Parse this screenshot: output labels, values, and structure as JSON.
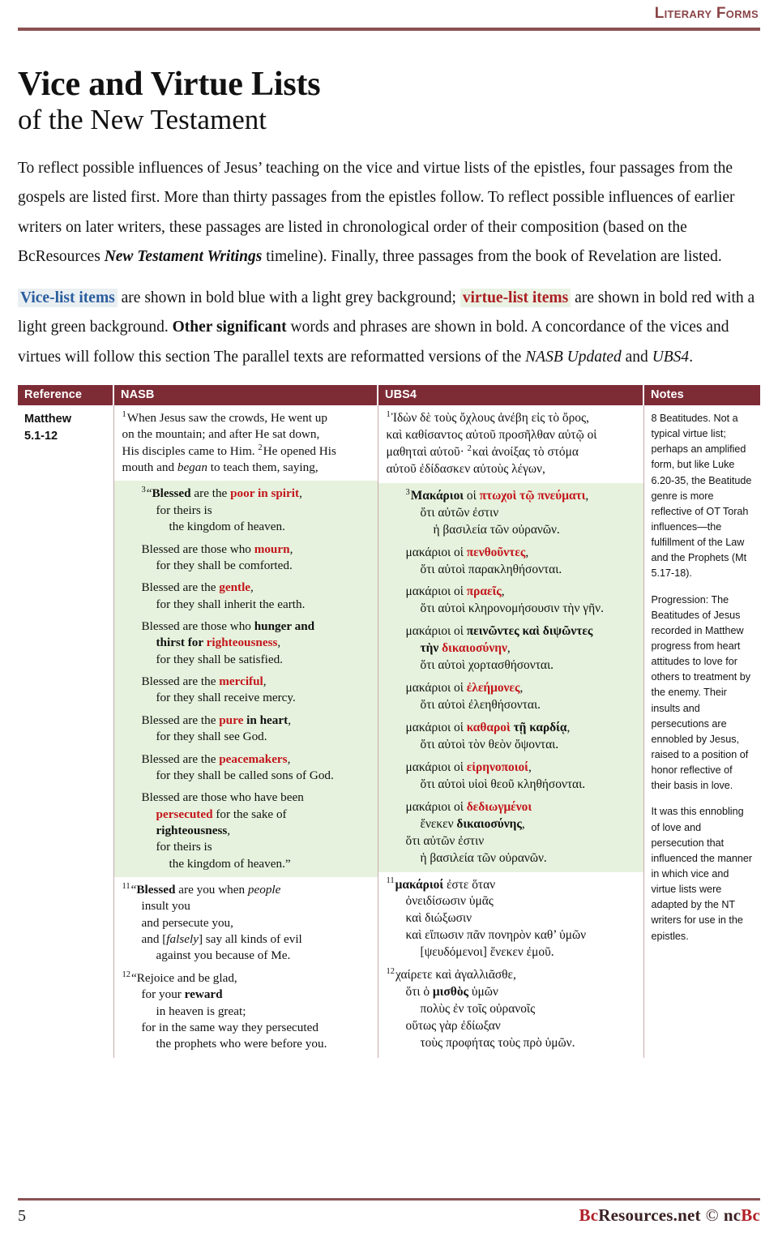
{
  "running_head": "Literary Forms",
  "title": {
    "main": "Vice and Virtue Lists",
    "sub": "of the New Testament"
  },
  "intro": {
    "p1_a": "To reflect possible influences of Jesus’ teaching on the vice and virtue lists of the epistles, four passages from the gospels are listed first. More than thirty passages from the epistles follow. To reflect possible influences of earlier writers on later writers, these passages are listed in chronological order of their composition (based on the BcResources ",
    "p1_italic": "New Testament Writings",
    "p1_b": " timeline). Finally, three passages from the book of Revelation are listed.",
    "p2_vice_kw": "Vice-list items",
    "p2_a": " are shown in bold blue with a light grey background; ",
    "p2_virtue_kw": "virtue-list items",
    "p2_b": " are shown in bold red with a light green background. ",
    "p2_bold": "Other significant",
    "p2_c": " words and phrases are shown in bold. A concordance of the vices and virtues will follow this section The parallel texts are reformatted versions of the ",
    "p2_italic1": "NASB Updated",
    "p2_d": " and ",
    "p2_italic2": "UBS4",
    "p2_e": "."
  },
  "table": {
    "headers": {
      "reference": "Reference",
      "nasb": "NASB",
      "ubs4": "UBS4",
      "notes": "Notes"
    },
    "row": {
      "reference_book": "Matthew",
      "reference_verses": "5.1-12",
      "nasb": {
        "intro": {
          "verse": "1",
          "lines": [
            "When Jesus saw the crowds, He went up",
            "on the mountain; and after He sat down,",
            "His disciples came to Him."
          ],
          "verse2": "2",
          "line2a": "He opened His",
          "line2b_pre": "mouth and ",
          "line2b_italic": "began",
          "line2b_post": " to teach them, saying,"
        },
        "beatitudes_verse": "3",
        "beatitudes": [
          {
            "open": "“",
            "blessed": "Blessed",
            "pre": " are the ",
            "virtue": "poor in spirit",
            "post": ",",
            "reason": [
              "for theirs is",
              "the kingdom of heaven."
            ]
          },
          {
            "pre": "Blessed are those who ",
            "virtue": "mourn",
            "post": ",",
            "reason": [
              "for they shall be comforted."
            ]
          },
          {
            "pre": "Blessed are the ",
            "virtue": "gentle",
            "post": ",",
            "reason": [
              "for they shall inherit the earth."
            ]
          },
          {
            "pre": "Blessed are those who ",
            "bold_a": "hunger and",
            "bold_b": "thirst for ",
            "virtue": "righteousness",
            "post": ",",
            "reason": [
              "for they shall be satisfied."
            ]
          },
          {
            "pre": "Blessed are the ",
            "virtue": "merciful",
            "post": ",",
            "reason": [
              "for they shall receive mercy."
            ]
          },
          {
            "pre": "Blessed are the ",
            "virtue": "pure",
            "bold_tail": " in heart",
            "post": ",",
            "reason": [
              "for they shall see God."
            ]
          },
          {
            "pre": "Blessed are the ",
            "virtue": "peacemakers",
            "post": ",",
            "reason": [
              "for they shall be called sons of God."
            ]
          },
          {
            "pre": "Blessed are those who have been",
            "virtue": "persecuted",
            "mid": " for the sake of",
            "bold_tail": "righteousness",
            "post": ",",
            "reason": [
              "for theirs is",
              "the kingdom of heaven.”"
            ]
          }
        ],
        "v11": {
          "num": "11",
          "open": "“",
          "blessed": "Blessed",
          "l1_post": " are you when ",
          "l1_italic": "people",
          "lines": [
            "insult you",
            "and persecute you,"
          ],
          "l4_pre": "and [",
          "l4_italic": "falsely",
          "l4_post": "] say all kinds of evil",
          "l5": "against you because of Me."
        },
        "v12": {
          "num": "12",
          "l1": "“Rejoice and be glad,",
          "l2_pre": "for your ",
          "l2_bold": "reward",
          "l3": "in heaven is great;",
          "l4": "for in the same way they persecuted",
          "l5": "the prophets who were before you."
        }
      },
      "ubs4": {
        "intro": {
          "verse": "1",
          "lines": [
            "Ἰδὼν δὲ τοὺς ὄχλους ἀνέβη εἰς τὸ ὄρος,",
            "καὶ καθίσαντος αὐτοῦ προσῆλθαν αὐτῷ οἱ"
          ],
          "line3_a": "μαθηταὶ αὐτοῦ· ",
          "verse2": "2",
          "line3_b": "καὶ ἀνοίξας τὸ στόμα",
          "line4": "αὐτοῦ ἐδίδασκεν αὐτοὺς λέγων,"
        },
        "beatitudes_verse": "3",
        "beatitudes": [
          {
            "blessed": "Μακάριοι",
            "pre": " οἱ ",
            "virtue": "πτωχοὶ τῷ πνεύματι",
            "post": ",",
            "reason": [
              "ὅτι αὐτῶν ἐστιν",
              "ἡ βασιλεία τῶν οὐρανῶν."
            ]
          },
          {
            "pre": "μακάριοι οἱ ",
            "virtue": "πενθοῦντες",
            "post": ",",
            "reason": [
              "ὅτι αὐτοὶ παρακληθήσονται."
            ]
          },
          {
            "pre": "μακάριοι οἱ ",
            "virtue": "πραεῖς",
            "post": ",",
            "reason": [
              "ὅτι αὐτοὶ κληρονομήσουσιν τὴν γῆν."
            ]
          },
          {
            "pre": "μακάριοι οἱ ",
            "bold_a": "πεινῶντες καὶ διψῶντες",
            "bold_b": "τὴν ",
            "virtue": "δικαιοσύνην",
            "post": ",",
            "reason": [
              "ὅτι αὐτοὶ χορτασθήσονται."
            ]
          },
          {
            "pre": "μακάριοι οἱ ",
            "virtue": "ἐλεήμονες",
            "post": ",",
            "reason": [
              "ὅτι αὐτοὶ ἐλεηθήσονται."
            ]
          },
          {
            "pre": "μακάριοι οἱ ",
            "virtue": "καθαροὶ",
            "bold_tail": " τῇ καρδίᾳ",
            "post": ",",
            "reason": [
              "ὅτι αὐτοὶ τὸν θεὸν ὄψονται."
            ]
          },
          {
            "pre": "μακάριοι οἱ ",
            "virtue": "εἰρηνοποιοί",
            "post": ",",
            "reason": [
              "ὅτι αὐτοὶ υἱοὶ θεοῦ κληθήσονται."
            ]
          },
          {
            "pre": "μακάριοι οἱ ",
            "virtue": "δεδιωγμένοι",
            "mid_pre": "ἕνεκεν ",
            "bold_tail": "δικαιοσύνης",
            "post": ",",
            "reason": [
              "ὅτι αὐτῶν ἐστιν",
              "ἡ βασιλεία τῶν οὐρανῶν."
            ]
          }
        ],
        "v11": {
          "num": "11",
          "bold": "μακάριοί",
          "l1_post": " ἐστε ὅταν",
          "lines": [
            "ὀνειδίσωσιν ὑμᾶς",
            "καὶ διώξωσιν",
            "καὶ εἴπωσιν πᾶν πονηρὸν καθ’ ὑμῶν"
          ],
          "l5": "[ψευδόμενοι] ἕνεκεν ἐμοῦ."
        },
        "v12": {
          "num": "12",
          "l1": "χαίρετε καὶ ἀγαλλιᾶσθε,",
          "l2_pre": "ὅτι ὁ ",
          "l2_bold": "μισθὸς",
          "l2_post": " ὑμῶν",
          "l3": "πολὺς ἐν τοῖς οὐρανοῖς",
          "l4": "οὕτως γὰρ ἐδίωξαν",
          "l5": "τοὺς προφήτας τοὺς πρὸ ὑμῶν."
        }
      },
      "notes": [
        "8 Beatitudes. Not a typical virtue list; perhaps an amplified form, but like Luke 6.20-35, the Beatitude genre is more reflective of OT Torah influences—the fulfillment of the Law and the Prophets (Mt 5.17-18).",
        "Progression: The Beatitudes of Jesus recorded in Matthew progress from heart attitudes to love for others to treatment by the enemy. Their insults and persecutions are ennobled by Jesus, raised to a position of honor reflective of their basis in love.",
        "It was this ennobling of love and persecution that influenced the manner in which vice and virtue lists were adapted by the NT writers for use in the epistles."
      ]
    }
  },
  "footer": {
    "page_number": "5",
    "brand_bc": "Bc",
    "brand_rest": "Resources.net",
    "copyright": "©",
    "brand_tail_nc": "nc",
    "brand_tail_bc": "Bc"
  },
  "colors": {
    "accent_maroon": "#7d2c36",
    "rule": "#8a5154",
    "vice_blue": "#2a5d9e",
    "virtue_red": "#ab1f22",
    "green_bg": "#e6f2dd",
    "grey_bg": "#eaeff2"
  }
}
